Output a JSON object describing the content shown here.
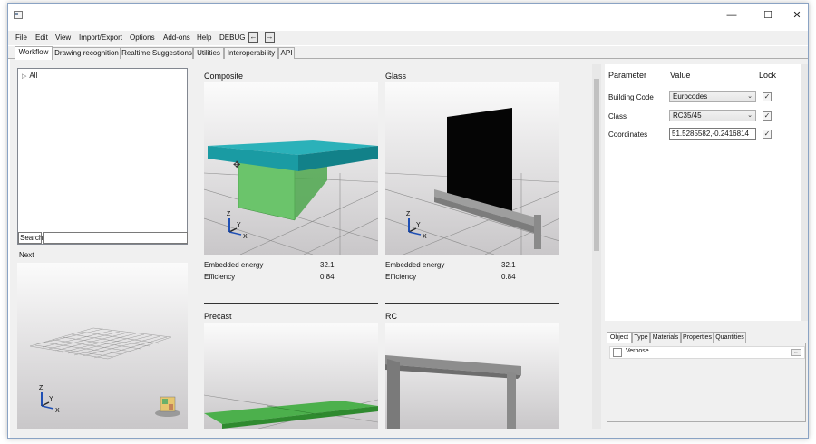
{
  "window": {
    "minimize_glyph": "—",
    "maximize_glyph": "☐",
    "close_glyph": "✕"
  },
  "menu": {
    "items": [
      "File",
      "Edit",
      "View",
      "Import/Export",
      "Options",
      "Add-ons",
      "Help",
      "DEBUG"
    ],
    "back_arrow": "←",
    "forward_arrow": "→"
  },
  "tabs": [
    "Workflow",
    "Drawing recognition",
    "Realtime Suggestions",
    "Utilities",
    "Interoperability",
    "API"
  ],
  "active_tab": "Workflow",
  "tree": {
    "root_label": "All",
    "search_label": "Search",
    "search_value": ""
  },
  "next_label": "Next",
  "cards": [
    {
      "title": "Composite",
      "metrics": [
        {
          "label": "Embedded energy",
          "value": "32.1"
        },
        {
          "label": "Efficiency",
          "value": "0.84"
        }
      ]
    },
    {
      "title": "Glass",
      "metrics": [
        {
          "label": "Embedded energy",
          "value": "32.1"
        },
        {
          "label": "Efficiency",
          "value": "0.84"
        }
      ]
    },
    {
      "title": "Precast"
    },
    {
      "title": "RC"
    }
  ],
  "params": {
    "headers": {
      "parameter": "Parameter",
      "value": "Value",
      "lock": "Lock"
    },
    "rows": [
      {
        "label": "Building Code",
        "value": "Eurocodes",
        "type": "combo",
        "locked": true
      },
      {
        "label": "Class",
        "value": "RC35/45",
        "type": "combo",
        "locked": true
      },
      {
        "label": "Coordinates",
        "value": "51.5285582,-0.2416814",
        "type": "text",
        "locked": true
      }
    ]
  },
  "props": {
    "tabs": [
      "Object",
      "Type",
      "Materials",
      "Properties",
      "Quantities"
    ],
    "active_tab": "Object",
    "verbose_label": "Verbose",
    "verbose_checked": false
  },
  "colors": {
    "composite_slab": "#1fa3ad",
    "steel_green": "#5fbf5f",
    "precast_green": "#4cb04c",
    "rc_grey": "#8d8d8d"
  }
}
